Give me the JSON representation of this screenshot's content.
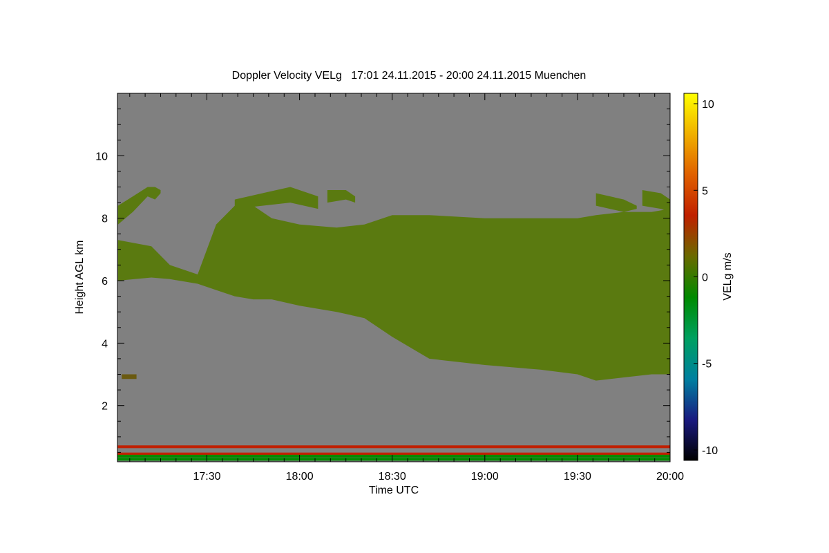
{
  "chart_data": {
    "type": "heatmap",
    "title": "Doppler Velocity VELg   17:01 24.11.2015 - 20:00 24.11.2015 Muenchen",
    "xlabel": "Time UTC",
    "ylabel": "Height AGL km",
    "colorbar_label": "VELg m/s",
    "x_range_hours": [
      17.017,
      20.0
    ],
    "y_range_km": [
      0.2,
      12.0
    ],
    "x_ticks": [
      {
        "value": 17.5,
        "label": "17:30"
      },
      {
        "value": 18.0,
        "label": "18:00"
      },
      {
        "value": 18.5,
        "label": "18:30"
      },
      {
        "value": 19.0,
        "label": "19:00"
      },
      {
        "value": 19.5,
        "label": "19:30"
      },
      {
        "value": 20.0,
        "label": "20:00"
      }
    ],
    "y_ticks": [
      {
        "value": 2,
        "label": "2"
      },
      {
        "value": 4,
        "label": "4"
      },
      {
        "value": 6,
        "label": "6"
      },
      {
        "value": 8,
        "label": "8"
      },
      {
        "value": 10,
        "label": "10"
      }
    ],
    "colorbar_range": [
      -10.6,
      10.6
    ],
    "colorbar_ticks": [
      {
        "value": 10,
        "label": "10"
      },
      {
        "value": 5,
        "label": "5"
      },
      {
        "value": 0,
        "label": "0"
      },
      {
        "value": -5,
        "label": "-5"
      },
      {
        "value": -10,
        "label": "-10"
      }
    ],
    "colorbar_colors": [
      "#000000",
      "#1a1a80",
      "#0080a0",
      "#00a060",
      "#008a00",
      "#6a6a00",
      "#c02000",
      "#e06000",
      "#f0b000",
      "#ffff00"
    ],
    "background_color": "#808080",
    "cloud_color": "#5a7a10",
    "cloud_layer": {
      "time_h": [
        17.02,
        17.2,
        17.3,
        17.45,
        17.55,
        17.65,
        17.75,
        17.85,
        18.0,
        18.2,
        18.35,
        18.5,
        18.7,
        19.0,
        19.3,
        19.5,
        19.6,
        19.75,
        19.9,
        20.0
      ],
      "top_km": [
        7.3,
        7.1,
        6.5,
        6.2,
        7.8,
        8.4,
        8.4,
        8.0,
        7.8,
        7.7,
        7.8,
        8.1,
        8.1,
        8.0,
        8.0,
        8.0,
        8.1,
        8.2,
        8.2,
        8.3
      ],
      "base_km": [
        6.0,
        6.1,
        6.05,
        5.9,
        5.7,
        5.5,
        5.4,
        5.4,
        5.2,
        5.0,
        4.8,
        4.2,
        3.5,
        3.3,
        3.15,
        3.0,
        2.8,
        2.9,
        3.0,
        3.0
      ]
    },
    "upper_patches": [
      {
        "time_h": [
          17.02,
          17.1,
          17.18,
          17.22,
          17.25
        ],
        "top_km": [
          8.4,
          8.7,
          9.0,
          9.0,
          8.9
        ],
        "base_km": [
          7.8,
          8.2,
          8.7,
          8.6,
          8.8
        ]
      },
      {
        "time_h": [
          17.65,
          17.8,
          17.95,
          18.1
        ],
        "top_km": [
          8.6,
          8.8,
          9.0,
          8.7
        ],
        "base_km": [
          8.3,
          8.4,
          8.5,
          8.3
        ]
      },
      {
        "time_h": [
          18.15,
          18.25,
          18.3
        ],
        "top_km": [
          8.9,
          8.9,
          8.7
        ],
        "base_km": [
          8.5,
          8.6,
          8.5
        ]
      },
      {
        "time_h": [
          19.6,
          19.75,
          19.82
        ],
        "top_km": [
          8.8,
          8.6,
          8.4
        ],
        "base_km": [
          8.4,
          8.2,
          8.3
        ]
      },
      {
        "time_h": [
          19.85,
          19.95,
          20.0
        ],
        "top_km": [
          8.9,
          8.8,
          8.6
        ],
        "base_km": [
          8.4,
          8.3,
          8.2
        ]
      }
    ],
    "low_patch": {
      "time_h": [
        17.04,
        17.12
      ],
      "top_km": [
        3.0,
        3.0
      ],
      "base_km": [
        2.85,
        2.85
      ]
    },
    "near_ground_bands": [
      {
        "height_km": 0.68,
        "color": "#c02000"
      },
      {
        "height_km": 0.45,
        "color": "#c02000"
      },
      {
        "height_km": 0.38,
        "color": "#008a00"
      },
      {
        "height_km": 0.28,
        "color": "#008a00"
      }
    ]
  }
}
